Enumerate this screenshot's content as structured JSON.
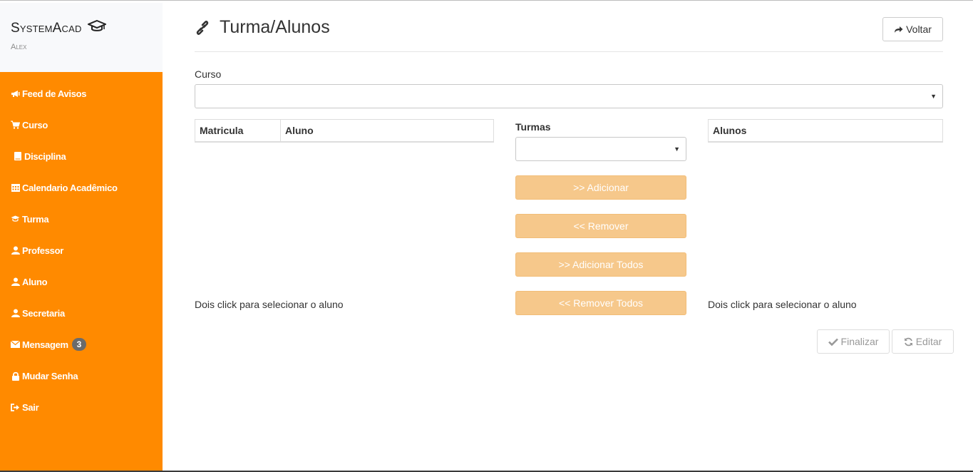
{
  "brand": {
    "title": "SystemAcad",
    "user": "Alex"
  },
  "sidebar": {
    "items": [
      {
        "label": "Feed de Avisos",
        "icon": "bullhorn-icon"
      },
      {
        "label": "Curso",
        "icon": "cart-icon"
      },
      {
        "label": "Disciplina",
        "icon": "book-icon"
      },
      {
        "label": "Calendario Acadêmico",
        "icon": "calendar-icon"
      },
      {
        "label": "Turma",
        "icon": "graduation-cap-icon"
      },
      {
        "label": "Professor",
        "icon": "user-icon"
      },
      {
        "label": "Aluno",
        "icon": "user-icon"
      },
      {
        "label": "Secretaria",
        "icon": "user-icon"
      },
      {
        "label": "Mensagem",
        "icon": "envelope-icon",
        "badge": "3"
      },
      {
        "label": "Mudar Senha",
        "icon": "lock-icon"
      },
      {
        "label": "Sair",
        "icon": "sign-out-icon"
      }
    ]
  },
  "header": {
    "title": "Turma/Alunos",
    "icon": "link-icon",
    "back_label": "Voltar"
  },
  "form": {
    "curso_label": "Curso",
    "curso_value": "",
    "turmas_label": "Turmas",
    "turmas_value": ""
  },
  "left_table": {
    "columns": [
      "Matricula",
      "Aluno"
    ],
    "hint": "Dois click para selecionar o aluno"
  },
  "right_table": {
    "columns": [
      "Alunos"
    ],
    "hint": "Dois click para selecionar o aluno"
  },
  "actions": {
    "add": ">>  Adicionar",
    "remove": "<<  Remover",
    "add_all": ">>  Adicionar Todos",
    "remove_all": "<<  Remover Todos",
    "finalizar": "Finalizar",
    "editar": "Editar"
  },
  "colors": {
    "sidebar_bg": "#ff8a00",
    "action_button_bg": "#f6c88b",
    "badge_bg": "#6b6b6b"
  }
}
